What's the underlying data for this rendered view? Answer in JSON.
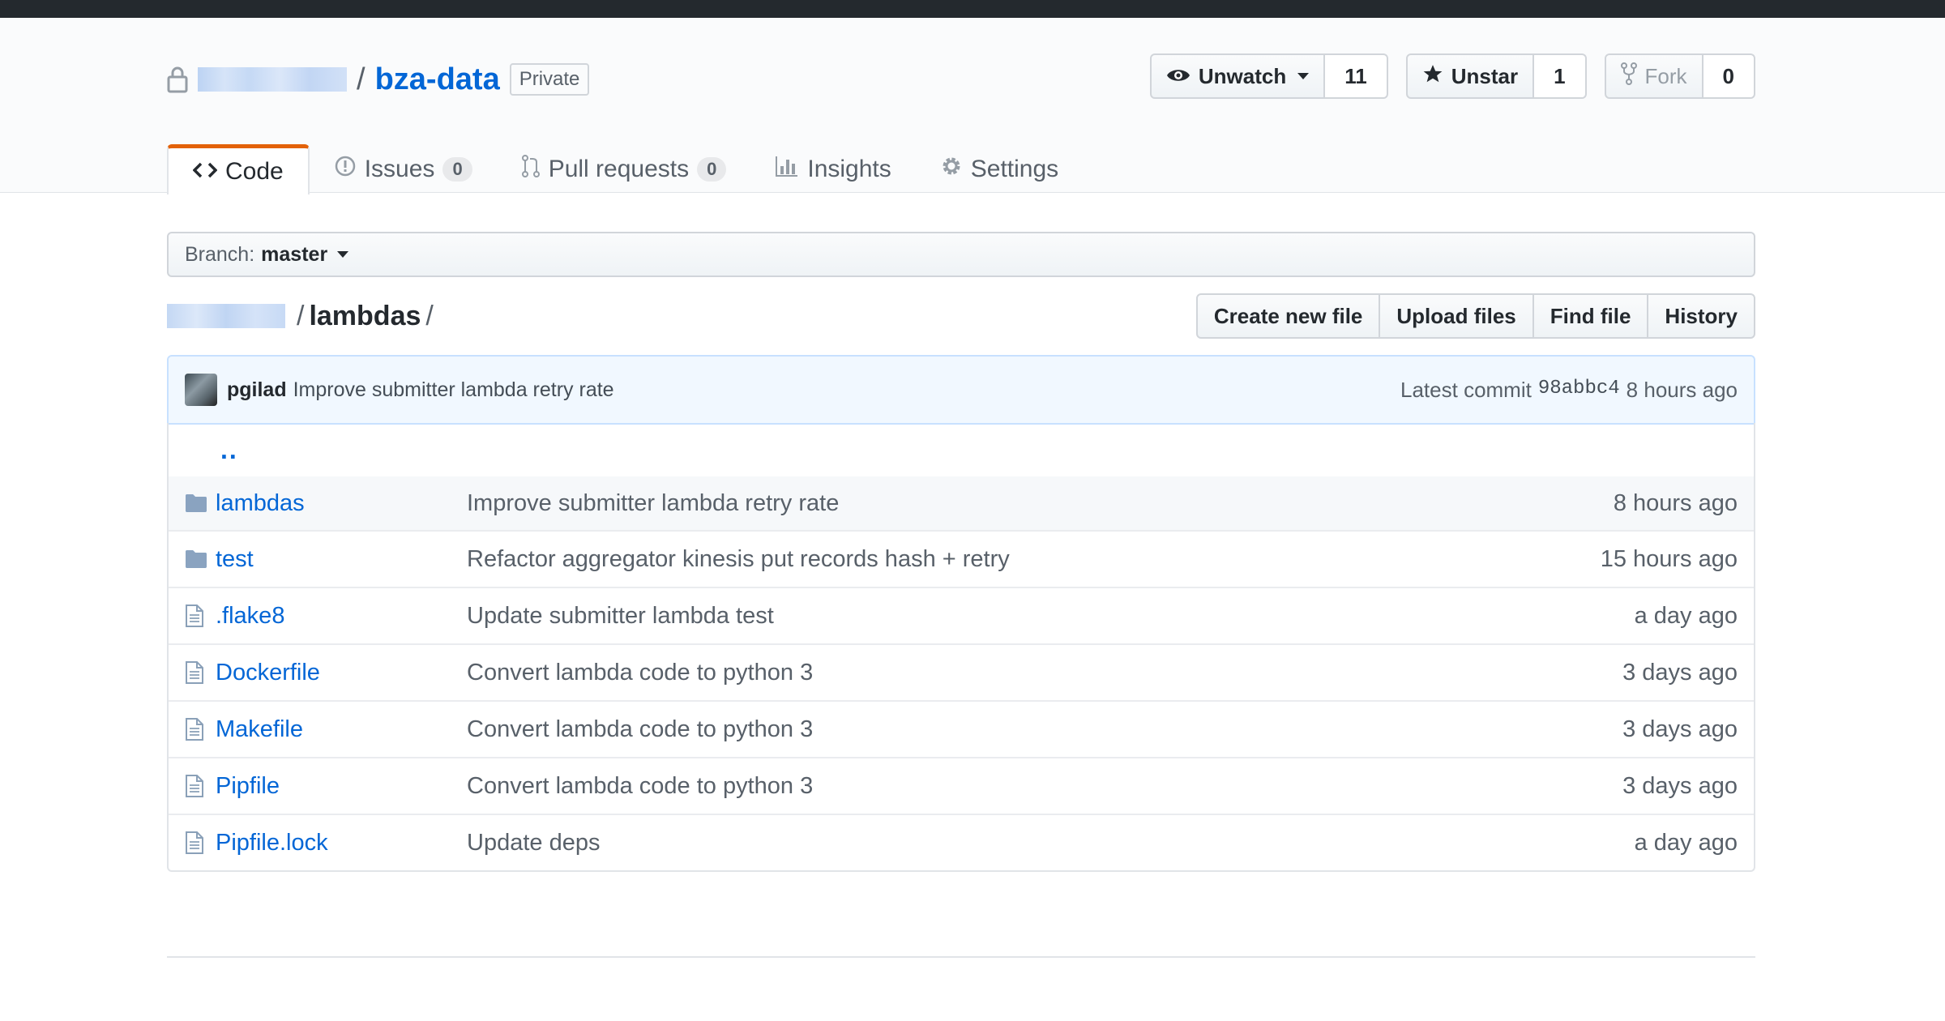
{
  "repo": {
    "separator": "/",
    "name": "bza-data",
    "visibility": "Private"
  },
  "actions": {
    "watch_label": "Unwatch",
    "watch_count": "11",
    "star_label": "Unstar",
    "star_count": "1",
    "fork_label": "Fork",
    "fork_count": "0"
  },
  "tabs": [
    {
      "label": "Code"
    },
    {
      "label": "Issues",
      "count": "0"
    },
    {
      "label": "Pull requests",
      "count": "0"
    },
    {
      "label": "Insights"
    },
    {
      "label": "Settings"
    }
  ],
  "branch": {
    "prefix": "Branch:",
    "name": "master"
  },
  "path": {
    "separator": "/",
    "current": "lambdas",
    "trailing": "/"
  },
  "file_nav": {
    "create": "Create new file",
    "upload": "Upload files",
    "find": "Find file",
    "history": "History"
  },
  "latest_commit": {
    "author": "pgilad",
    "message": "Improve submitter lambda retry rate",
    "prefix": "Latest commit",
    "sha": "98abbc4",
    "age": "8 hours ago"
  },
  "up_dir": "..",
  "files": [
    {
      "name": "lambdas",
      "type": "folder",
      "message": "Improve submitter lambda retry rate",
      "age": "8 hours ago"
    },
    {
      "name": "test",
      "type": "folder",
      "message": "Refactor aggregator kinesis put records hash + retry",
      "age": "15 hours ago"
    },
    {
      "name": ".flake8",
      "type": "file",
      "message": "Update submitter lambda test",
      "age": "a day ago"
    },
    {
      "name": "Dockerfile",
      "type": "file",
      "message": "Convert lambda code to python 3",
      "age": "3 days ago"
    },
    {
      "name": "Makefile",
      "type": "file",
      "message": "Convert lambda code to python 3",
      "age": "3 days ago"
    },
    {
      "name": "Pipfile",
      "type": "file",
      "message": "Convert lambda code to python 3",
      "age": "3 days ago"
    },
    {
      "name": "Pipfile.lock",
      "type": "file",
      "message": "Update deps",
      "age": "a day ago"
    }
  ]
}
